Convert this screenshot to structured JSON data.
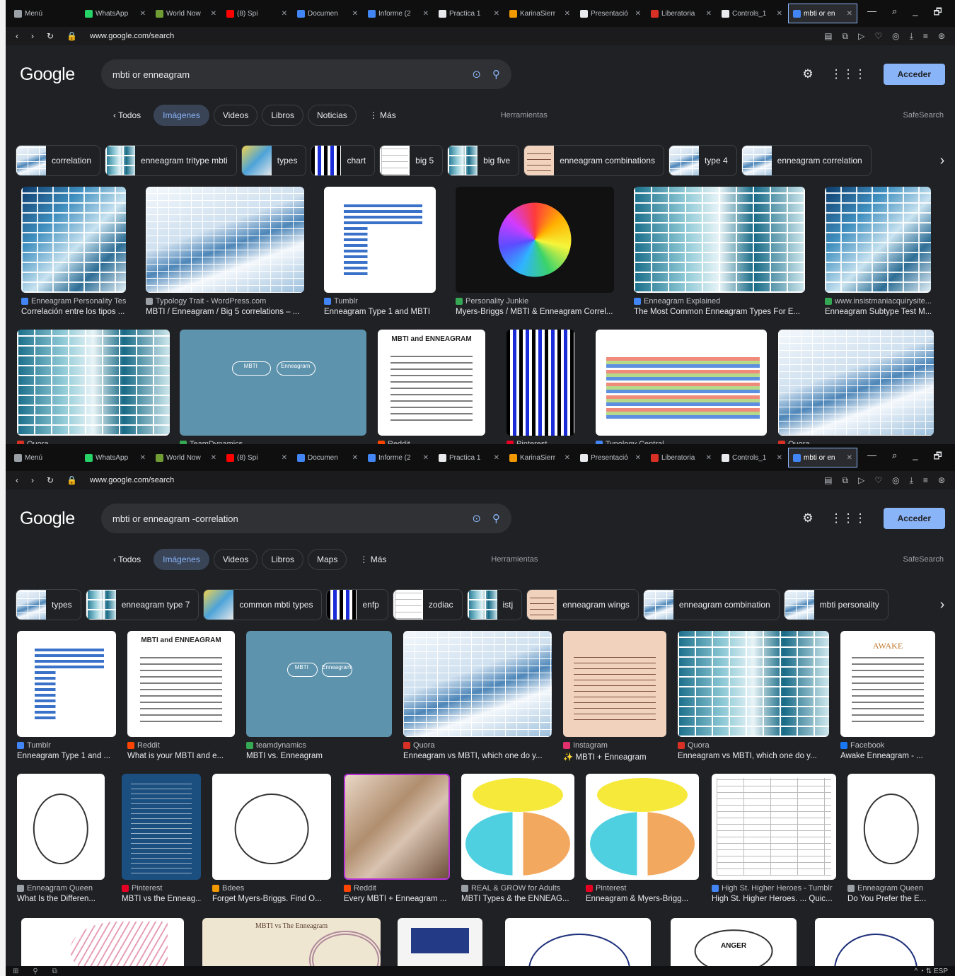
{
  "browser_tabs": [
    {
      "label": "Menú",
      "color": "#9aa0a6"
    },
    {
      "label": "WhatsApp",
      "color": "#25d366"
    },
    {
      "label": "World Now",
      "color": "#6f9d34"
    },
    {
      "label": "(8) Spi",
      "color": "#ff0000"
    },
    {
      "label": "Documen",
      "color": "#4285f4"
    },
    {
      "label": "Informe (2",
      "color": "#4285f4"
    },
    {
      "label": "Practica 1",
      "color": "#e8eaed"
    },
    {
      "label": "KarinaSierr",
      "color": "#f29900"
    },
    {
      "label": "Presentació",
      "color": "#e8eaed"
    },
    {
      "label": "Liberatoria",
      "color": "#d93025"
    },
    {
      "label": "Controls_1",
      "color": "#e8eaed"
    },
    {
      "label": "mbti or en",
      "color": "#4285f4"
    }
  ],
  "window_controls": [
    "—",
    "⌕",
    "_",
    "🗗",
    "✕"
  ],
  "url": "www.google.com/search",
  "logo": "Google",
  "signin_label": "Acceder",
  "filters_1": [
    "Todos",
    "Imágenes",
    "Videos",
    "Libros",
    "Noticias",
    "⋮ Más"
  ],
  "filters_2": [
    "Todos",
    "Imágenes",
    "Videos",
    "Libros",
    "Maps",
    "⋮ Más"
  ],
  "tools_label": "Herramientas",
  "safesearch_label": "SafeSearch",
  "query_1": "mbti or enneagram",
  "query_2": "mbti or enneagram -correlation",
  "chips_1": [
    {
      "label": "correlation"
    },
    {
      "label": "enneagram tritype mbti"
    },
    {
      "label": "types"
    },
    {
      "label": "chart"
    },
    {
      "label": "big 5"
    },
    {
      "label": "big five"
    },
    {
      "label": "enneagram combinations"
    },
    {
      "label": "type 4"
    },
    {
      "label": "enneagram correlation"
    }
  ],
  "chips_2": [
    {
      "label": "types"
    },
    {
      "label": "enneagram type 7"
    },
    {
      "label": "common mbti types"
    },
    {
      "label": "enfp"
    },
    {
      "label": "zodiac"
    },
    {
      "label": "istj"
    },
    {
      "label": "enneagram wings"
    },
    {
      "label": "enneagram combination"
    },
    {
      "label": "mbti personality"
    }
  ],
  "results_1_row1": [
    {
      "source": "Enneagram Personality Test",
      "title": "Correlación entre los tipos ...",
      "color": "#4285f4"
    },
    {
      "source": "Typology Trait - WordPress.com",
      "title": "MBTI / Enneagram / Big 5 correlations – ...",
      "color": "#9aa0a6"
    },
    {
      "source": "Tumblr",
      "title": "Enneagram Type 1 and MBTI",
      "color": "#4285f4"
    },
    {
      "source": "Personality Junkie",
      "title": "Myers-Briggs / MBTI & Enneagram Correl...",
      "color": "#34a853"
    },
    {
      "source": "Enneagram Explained",
      "title": "The Most Common Enneagram Types For E...",
      "color": "#4285f4"
    },
    {
      "source": "www.insistmaniacquirysite...",
      "title": "Enneagram Subtype Test M...",
      "color": "#34a853"
    }
  ],
  "results_1_row2": [
    {
      "source": "Quora",
      "color": "#d93025"
    },
    {
      "source": "TeamDynamics",
      "color": "#34a853"
    },
    {
      "source": "Reddit",
      "color": "#ff4500"
    },
    {
      "source": "Pinterest",
      "color": "#e60023"
    },
    {
      "source": "Typology Central",
      "color": "#4285f4"
    },
    {
      "source": "Quora",
      "color": "#d93025"
    }
  ],
  "results_2_row1": [
    {
      "source": "Tumblr",
      "title": "Enneagram Type 1 and ...",
      "color": "#4285f4"
    },
    {
      "source": "Reddit",
      "title": "What is your MBTI and e...",
      "color": "#ff4500"
    },
    {
      "source": "teamdynamics",
      "title": "MBTI vs. Enneagram",
      "color": "#34a853"
    },
    {
      "source": "Quora",
      "title": "Enneagram vs MBTI, which one do y...",
      "color": "#d93025"
    },
    {
      "source": "Instagram",
      "title": "✨ MBTI + Enneagram",
      "color": "#e1306c"
    },
    {
      "source": "Quora",
      "title": "Enneagram vs MBTI, which one do y...",
      "color": "#d93025"
    },
    {
      "source": "Facebook",
      "title": "Awake Enneagram - ...",
      "color": "#1877f2"
    }
  ],
  "results_2_row2": [
    {
      "source": "Enneagram Queen",
      "title": "What Is the Differen...",
      "color": "#9aa0a6"
    },
    {
      "source": "Pinterest",
      "title": "MBTI vs the Enneag...",
      "color": "#e60023"
    },
    {
      "source": "Bdees",
      "title": "Forget Myers-Briggs. Find O...",
      "color": "#f29900"
    },
    {
      "source": "Reddit",
      "title": "Every MBTI + Enneagram ...",
      "color": "#ff4500"
    },
    {
      "source": "REAL & GROW for Adults",
      "title": "MBTI Types & the ENNEAG...",
      "color": "#9aa0a6"
    },
    {
      "source": "Pinterest",
      "title": "Enneagram & Myers-Brigg...",
      "color": "#e60023"
    },
    {
      "source": "High St. Higher Heroes - Tumblr",
      "title": "High St. Higher Heroes. ... Quic...",
      "color": "#4285f4"
    },
    {
      "source": "Enneagram Queen",
      "title": "Do You Prefer the E...",
      "color": "#9aa0a6"
    }
  ],
  "thumb_texts": {
    "mbti_and_enneagram": "MBTI and ENNEAGRAM",
    "mbti_btn": "MBTI",
    "enneagram_btn": "Enneagram",
    "awake": "AWAKE",
    "mbti_vs": "MBTI vs The Enneagram",
    "anger": "ANGER"
  }
}
